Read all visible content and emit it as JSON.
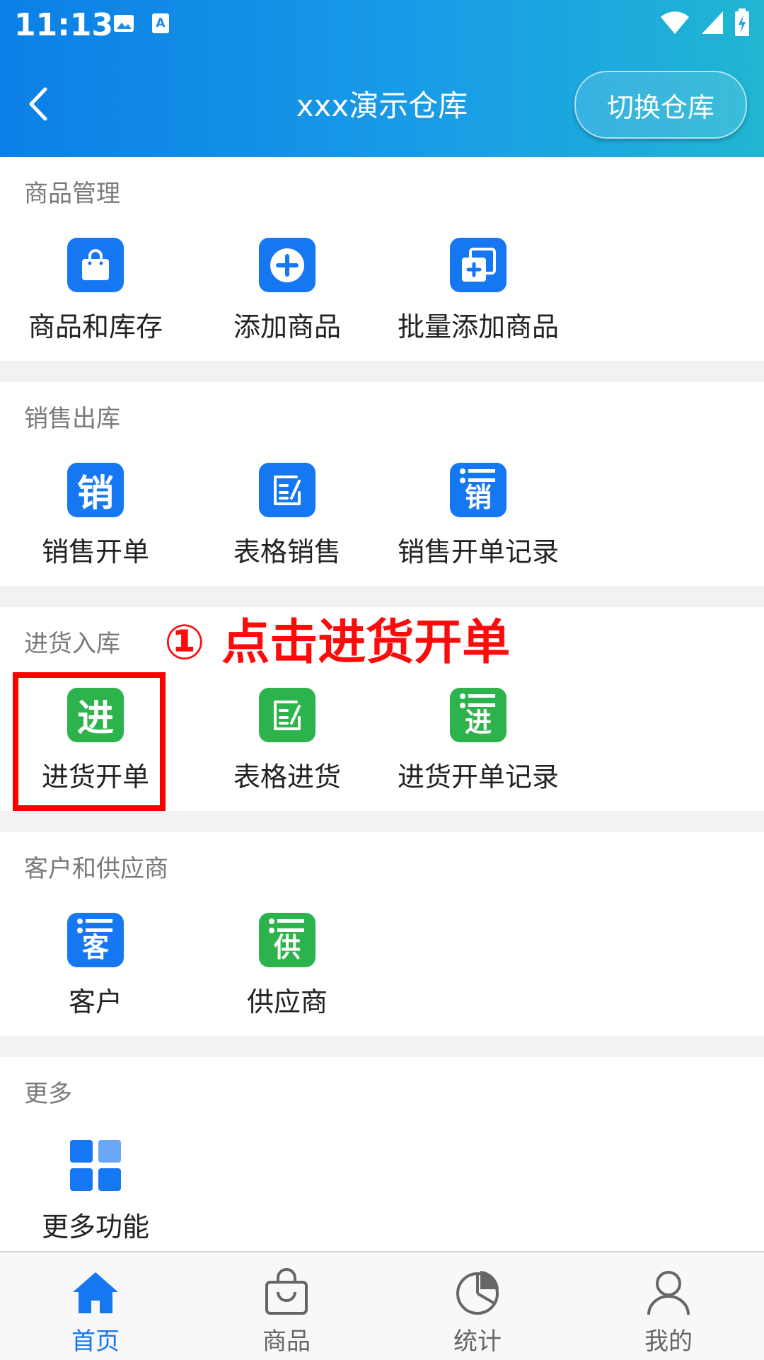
{
  "status_bar": {
    "time": "11:13"
  },
  "header": {
    "title": "xxx演示仓库",
    "switch_label": "切换仓库"
  },
  "sections": [
    {
      "title": "商品管理",
      "items": [
        {
          "label": "商品和库存",
          "icon": "shopping-bag-icon"
        },
        {
          "label": "添加商品",
          "icon": "plus-circle-icon"
        },
        {
          "label": "批量添加商品",
          "icon": "batch-add-icon"
        }
      ]
    },
    {
      "title": "销售出库",
      "items": [
        {
          "label": "销售开单",
          "icon": "sales-char-icon",
          "char": "销"
        },
        {
          "label": "表格销售",
          "icon": "form-edit-icon"
        },
        {
          "label": "销售开单记录",
          "icon": "sales-list-icon",
          "char": "销"
        }
      ]
    },
    {
      "title": "进货入库",
      "items": [
        {
          "label": "进货开单",
          "icon": "purchase-char-icon",
          "char": "进"
        },
        {
          "label": "表格进货",
          "icon": "form-edit-icon"
        },
        {
          "label": "进货开单记录",
          "icon": "purchase-list-icon",
          "char": "进"
        }
      ]
    },
    {
      "title": "客户和供应商",
      "items": [
        {
          "label": "客户",
          "icon": "customer-list-icon",
          "char": "客"
        },
        {
          "label": "供应商",
          "icon": "supplier-list-icon",
          "char": "供"
        }
      ]
    },
    {
      "title": "更多",
      "items": [
        {
          "label": "更多功能",
          "icon": "grid-icon"
        }
      ]
    }
  ],
  "annotation": "① 点击进货开单",
  "tabs": [
    {
      "label": "首页",
      "icon": "home-icon",
      "active": true
    },
    {
      "label": "商品",
      "icon": "shopping-bag-icon"
    },
    {
      "label": "统计",
      "icon": "pie-chart-icon"
    },
    {
      "label": "我的",
      "icon": "user-icon"
    }
  ],
  "colors": {
    "accent": "#1677f2",
    "green": "#2db34b",
    "annotation": "#ff0a0a"
  }
}
